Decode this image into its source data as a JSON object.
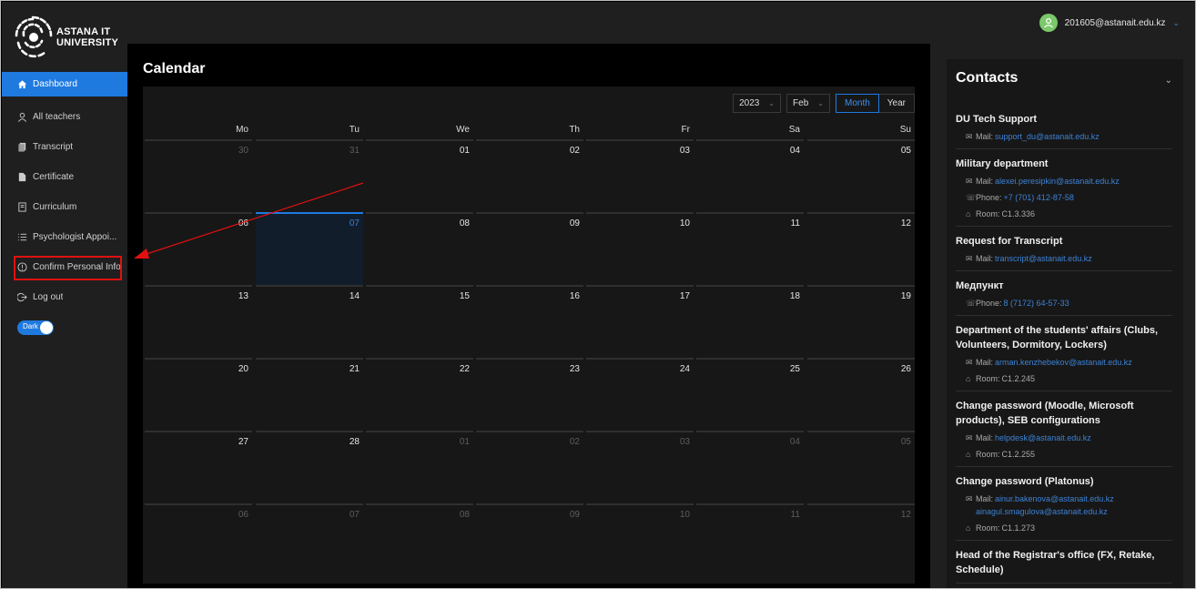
{
  "app": {
    "logo_line1": "ASTANA IT",
    "logo_line2": "UNIVERSITY"
  },
  "user": {
    "email": "201605@astanait.edu.kz"
  },
  "sidebar": {
    "items": [
      {
        "label": "Dashboard",
        "icon": "home-icon",
        "active": true
      },
      {
        "label": "All teachers",
        "icon": "user-icon"
      },
      {
        "label": "Transcript",
        "icon": "documents-icon"
      },
      {
        "label": "Certificate",
        "icon": "file-icon"
      },
      {
        "label": "Curriculum",
        "icon": "book-icon"
      },
      {
        "label": "Psychologist Appoi...",
        "icon": "list-icon"
      },
      {
        "label": "Confirm Personal Info",
        "icon": "info-circle-icon"
      },
      {
        "label": "Log out",
        "icon": "logout-icon"
      }
    ],
    "theme_toggle_label": "Dark"
  },
  "calendar": {
    "title": "Calendar",
    "year": "2023",
    "month": "Feb",
    "view_month": "Month",
    "view_year": "Year",
    "weekdays": [
      "Mo",
      "Tu",
      "We",
      "Th",
      "Fr",
      "Sa",
      "Su"
    ],
    "weeks": [
      [
        {
          "d": "30",
          "o": true
        },
        {
          "d": "31",
          "o": true
        },
        {
          "d": "01"
        },
        {
          "d": "02"
        },
        {
          "d": "03"
        },
        {
          "d": "04"
        },
        {
          "d": "05"
        }
      ],
      [
        {
          "d": "06"
        },
        {
          "d": "07",
          "today": true
        },
        {
          "d": "08"
        },
        {
          "d": "09"
        },
        {
          "d": "10"
        },
        {
          "d": "11"
        },
        {
          "d": "12"
        }
      ],
      [
        {
          "d": "13"
        },
        {
          "d": "14"
        },
        {
          "d": "15"
        },
        {
          "d": "16"
        },
        {
          "d": "17"
        },
        {
          "d": "18"
        },
        {
          "d": "19"
        }
      ],
      [
        {
          "d": "20"
        },
        {
          "d": "21"
        },
        {
          "d": "22"
        },
        {
          "d": "23"
        },
        {
          "d": "24"
        },
        {
          "d": "25"
        },
        {
          "d": "26"
        }
      ],
      [
        {
          "d": "27"
        },
        {
          "d": "28"
        },
        {
          "d": "01",
          "o": true
        },
        {
          "d": "02",
          "o": true
        },
        {
          "d": "03",
          "o": true
        },
        {
          "d": "04",
          "o": true
        },
        {
          "d": "05",
          "o": true
        }
      ],
      [
        {
          "d": "06",
          "o": true
        },
        {
          "d": "07",
          "o": true
        },
        {
          "d": "08",
          "o": true
        },
        {
          "d": "09",
          "o": true
        },
        {
          "d": "10",
          "o": true
        },
        {
          "d": "11",
          "o": true
        },
        {
          "d": "12",
          "o": true
        }
      ]
    ]
  },
  "contacts": {
    "title": "Contacts",
    "items": [
      {
        "name": "DU Tech Support",
        "rows": [
          {
            "icon": "mail-icon",
            "key": "Mail:",
            "links": [
              "support_du@astanait.edu.kz"
            ]
          }
        ]
      },
      {
        "name": "Military department",
        "rows": [
          {
            "icon": "mail-icon",
            "key": "Mail:",
            "links": [
              "alexei.peresipkin@astanait.edu.kz"
            ]
          },
          {
            "icon": "phone-icon",
            "key": "Phone:",
            "links": [
              "+7 (701) 412-87-58"
            ]
          },
          {
            "icon": "room-icon",
            "key": "Room:",
            "text": "C1.3.336"
          }
        ]
      },
      {
        "name": "Request for Transcript",
        "rows": [
          {
            "icon": "mail-icon",
            "key": "Mail:",
            "links": [
              "transcript@astanait.edu.kz"
            ]
          }
        ]
      },
      {
        "name": "Медпункт",
        "rows": [
          {
            "icon": "phone-icon",
            "key": "Phone:",
            "links": [
              "8 (7172) 64-57-33"
            ]
          }
        ]
      },
      {
        "name": "Department of the students' affairs (Clubs, Volunteers, Dormitory, Lockers)",
        "rows": [
          {
            "icon": "mail-icon",
            "key": "Mail:",
            "links": [
              "arman.kenzhebekov@astanait.edu.kz"
            ]
          },
          {
            "icon": "room-icon",
            "key": "Room:",
            "text": "C1.2.245"
          }
        ]
      },
      {
        "name": "Change password (Moodle, Microsoft products), SEB configurations",
        "rows": [
          {
            "icon": "mail-icon",
            "key": "Mail:",
            "links": [
              "helpdesk@astanait.edu.kz"
            ]
          },
          {
            "icon": "room-icon",
            "key": "Room:",
            "text": "C1.2.255"
          }
        ]
      },
      {
        "name": "Change password (Platonus)",
        "rows": [
          {
            "icon": "mail-icon",
            "key": "Mail:",
            "links": [
              "ainur.bakenova@astanait.edu.kz",
              "ainagul.smagulova@astanait.edu.kz"
            ]
          },
          {
            "icon": "room-icon",
            "key": "Room:",
            "text": "C1.1.273"
          }
        ]
      },
      {
        "name": "Head of the Registrar's office (FX, Retake, Schedule)",
        "rows": []
      }
    ]
  },
  "colors": {
    "accent": "#1f7ae0",
    "link": "#3c82d6",
    "annotation": "#e01010"
  }
}
